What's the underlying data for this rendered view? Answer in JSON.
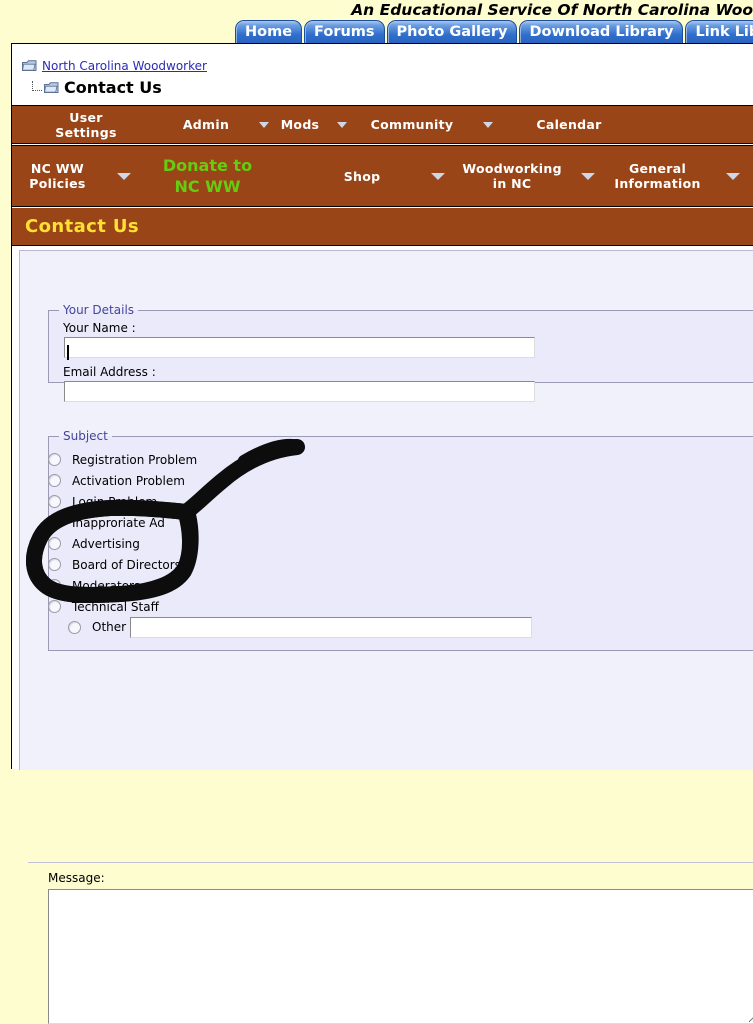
{
  "banner": {
    "tagline": "An Educational Service Of North Carolina Woo"
  },
  "tabs": [
    {
      "label": "Home"
    },
    {
      "label": "Forums"
    },
    {
      "label": "Photo Gallery"
    },
    {
      "label": "Download Library"
    },
    {
      "label": "Link Libr"
    }
  ],
  "breadcrumb": {
    "root": "North Carolina Woodworker",
    "current": "Contact Us"
  },
  "nav_primary": [
    {
      "label": "User\nSettings",
      "caret": false
    },
    {
      "label": "Admin",
      "caret": true
    },
    {
      "label": "Mods",
      "caret": true
    },
    {
      "label": "Community",
      "caret": true
    },
    {
      "label": "Calendar",
      "caret": false
    }
  ],
  "nav_secondary": [
    {
      "label": "NC WW\nPolicies",
      "caret": true,
      "green": false
    },
    {
      "label": "Donate to\nNC WW",
      "caret": false,
      "green": true
    },
    {
      "label": "Shop",
      "caret": true,
      "green": false
    },
    {
      "label": "Woodworking\nin NC",
      "caret": true,
      "green": false
    },
    {
      "label": "General\nInformation",
      "caret": true,
      "green": false
    }
  ],
  "page_title": "Contact Us",
  "form": {
    "details_legend": "Your Details",
    "name_label": "Your Name :",
    "name_value": "",
    "email_label": "Email Address :",
    "email_value": "",
    "subject_legend": "Subject",
    "subject_options": [
      "Registration Problem",
      "Activation Problem",
      "Login Problem",
      "Inapproriate Ad",
      "Advertising",
      "Board of Directors",
      "Moderators",
      "Technical Staff"
    ],
    "other_label": "Other",
    "other_value": "",
    "message_label": "Message:",
    "message_value": ""
  },
  "colors": {
    "page_background": "#fdfdcf",
    "nav_brown": "#9a4518",
    "title_yellow": "#ffe033",
    "donate_green": "#66cc11",
    "tab_blue": "#2f6fcd",
    "panel_lavender": "#f1f1fc",
    "fieldset_lavender": "#eaeafa",
    "link_blue": "#2b2bb5",
    "annotation_ink": "#000000"
  },
  "annotation": {
    "type": "hand-drawn-marker",
    "shape": "loop-with-pointer-arrow",
    "encircles": [
      "Advertising",
      "Board of Directors",
      "Moderators",
      "Technical Staff",
      "Other"
    ]
  }
}
